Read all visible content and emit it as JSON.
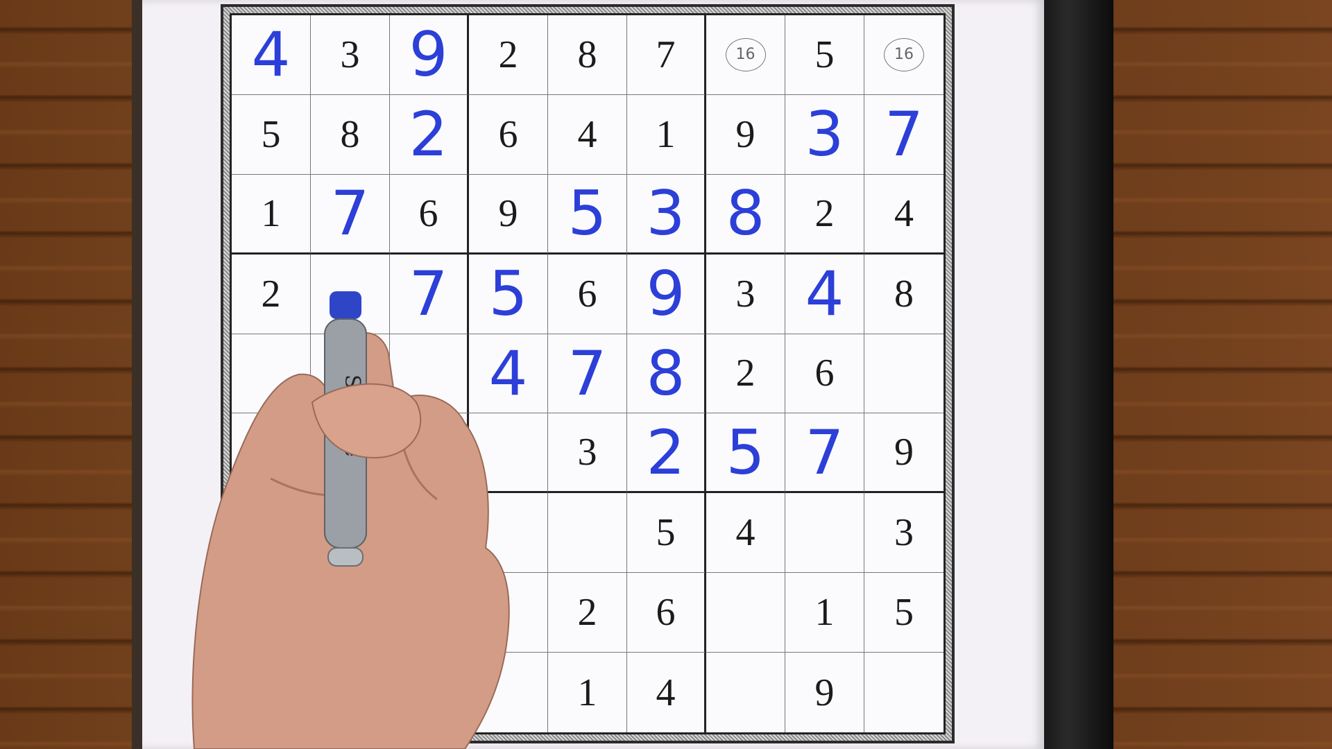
{
  "colors": {
    "ink_blue": "#2c3fd8",
    "print_black": "#1b1b1b",
    "paper": "#f4f1f6",
    "wood": "#6b3d1c"
  },
  "marker": {
    "brand_text": "Sharpie"
  },
  "sudoku": {
    "rows": [
      [
        {
          "v": "4",
          "t": "hand"
        },
        {
          "v": "3",
          "t": "print"
        },
        {
          "v": "9",
          "t": "hand"
        },
        {
          "v": "2",
          "t": "print"
        },
        {
          "v": "8",
          "t": "print"
        },
        {
          "v": "7",
          "t": "print"
        },
        {
          "v": "16",
          "t": "note"
        },
        {
          "v": "5",
          "t": "print"
        },
        {
          "v": "16",
          "t": "note"
        }
      ],
      [
        {
          "v": "5",
          "t": "print"
        },
        {
          "v": "8",
          "t": "print"
        },
        {
          "v": "2",
          "t": "hand"
        },
        {
          "v": "6",
          "t": "print"
        },
        {
          "v": "4",
          "t": "print"
        },
        {
          "v": "1",
          "t": "print"
        },
        {
          "v": "9",
          "t": "print"
        },
        {
          "v": "3",
          "t": "hand"
        },
        {
          "v": "7",
          "t": "hand"
        }
      ],
      [
        {
          "v": "1",
          "t": "print"
        },
        {
          "v": "7",
          "t": "hand"
        },
        {
          "v": "6",
          "t": "print"
        },
        {
          "v": "9",
          "t": "print"
        },
        {
          "v": "5",
          "t": "hand"
        },
        {
          "v": "3",
          "t": "hand"
        },
        {
          "v": "8",
          "t": "hand"
        },
        {
          "v": "2",
          "t": "print"
        },
        {
          "v": "4",
          "t": "print"
        }
      ],
      [
        {
          "v": "2",
          "t": "print"
        },
        {
          "v": "",
          "t": "empty"
        },
        {
          "v": "7",
          "t": "hand"
        },
        {
          "v": "5",
          "t": "hand"
        },
        {
          "v": "6",
          "t": "print"
        },
        {
          "v": "9",
          "t": "hand"
        },
        {
          "v": "3",
          "t": "print"
        },
        {
          "v": "4",
          "t": "hand"
        },
        {
          "v": "8",
          "t": "print"
        }
      ],
      [
        {
          "v": "",
          "t": "empty"
        },
        {
          "v": "",
          "t": "empty"
        },
        {
          "v": "",
          "t": "empty"
        },
        {
          "v": "4",
          "t": "hand"
        },
        {
          "v": "7",
          "t": "hand"
        },
        {
          "v": "8",
          "t": "hand"
        },
        {
          "v": "2",
          "t": "print"
        },
        {
          "v": "6",
          "t": "print"
        },
        {
          "v": "",
          "t": "empty"
        }
      ],
      [
        {
          "v": "",
          "t": "empty"
        },
        {
          "v": "",
          "t": "empty"
        },
        {
          "v": "",
          "t": "empty"
        },
        {
          "v": "",
          "t": "empty"
        },
        {
          "v": "3",
          "t": "print"
        },
        {
          "v": "2",
          "t": "hand"
        },
        {
          "v": "5",
          "t": "hand"
        },
        {
          "v": "7",
          "t": "hand"
        },
        {
          "v": "9",
          "t": "print"
        }
      ],
      [
        {
          "v": "",
          "t": "empty"
        },
        {
          "v": "",
          "t": "empty"
        },
        {
          "v": "",
          "t": "empty"
        },
        {
          "v": "",
          "t": "empty"
        },
        {
          "v": "",
          "t": "empty"
        },
        {
          "v": "5",
          "t": "print"
        },
        {
          "v": "4",
          "t": "print"
        },
        {
          "v": "",
          "t": "empty"
        },
        {
          "v": "3",
          "t": "print"
        }
      ],
      [
        {
          "v": "",
          "t": "empty"
        },
        {
          "v": "",
          "t": "empty"
        },
        {
          "v": "",
          "t": "empty"
        },
        {
          "v": "",
          "t": "empty"
        },
        {
          "v": "2",
          "t": "print"
        },
        {
          "v": "6",
          "t": "print"
        },
        {
          "v": "",
          "t": "empty"
        },
        {
          "v": "1",
          "t": "print"
        },
        {
          "v": "5",
          "t": "print"
        }
      ],
      [
        {
          "v": "",
          "t": "empty"
        },
        {
          "v": "",
          "t": "empty"
        },
        {
          "v": "",
          "t": "empty"
        },
        {
          "v": "",
          "t": "empty"
        },
        {
          "v": "1",
          "t": "print"
        },
        {
          "v": "4",
          "t": "print"
        },
        {
          "v": "",
          "t": "empty"
        },
        {
          "v": "9",
          "t": "print"
        },
        {
          "v": "",
          "t": "empty"
        }
      ]
    ]
  }
}
